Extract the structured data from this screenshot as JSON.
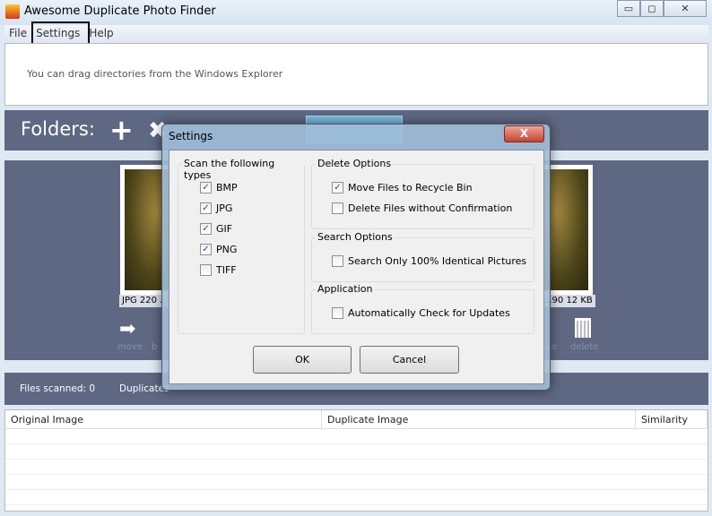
{
  "window": {
    "title": "Awesome Duplicate Photo Finder",
    "minimize": "▭",
    "maximize": "◻",
    "close": "✕"
  },
  "menu": [
    "File",
    "Settings",
    "Help"
  ],
  "drop_hint": "You can drag directories from the Windows Explorer",
  "folders": {
    "label": "Folders:",
    "add": "+",
    "remove": "✖"
  },
  "images": {
    "left_info": "JPG  220 ...",
    "right_info": "...90  12 KB",
    "actions": {
      "move": "move",
      "browse": "b",
      "delete": "delete",
      "close": "se"
    }
  },
  "status": {
    "files_scanned": "Files scanned: 0",
    "duplicates": "Duplicates"
  },
  "table": {
    "columns": [
      "Original Image",
      "Duplicate Image",
      "Similarity"
    ]
  },
  "dialog": {
    "title": "Settings",
    "close": "X",
    "scan_types": {
      "title": "Scan the following types",
      "items": [
        {
          "label": "BMP",
          "checked": true
        },
        {
          "label": "JPG",
          "checked": true
        },
        {
          "label": "GIF",
          "checked": true
        },
        {
          "label": "PNG",
          "checked": true
        },
        {
          "label": "TIFF",
          "checked": false
        }
      ]
    },
    "delete_options": {
      "title": "Delete Options",
      "items": [
        {
          "label": "Move Files to Recycle Bin",
          "checked": true
        },
        {
          "label": "Delete Files without Confirmation",
          "checked": false
        }
      ]
    },
    "search_options": {
      "title": "Search Options",
      "items": [
        {
          "label": "Search Only 100% Identical Pictures",
          "checked": false
        }
      ]
    },
    "application": {
      "title": "Application",
      "items": [
        {
          "label": "Automatically Check for Updates",
          "checked": false
        }
      ]
    },
    "ok": "OK",
    "cancel": "Cancel"
  }
}
